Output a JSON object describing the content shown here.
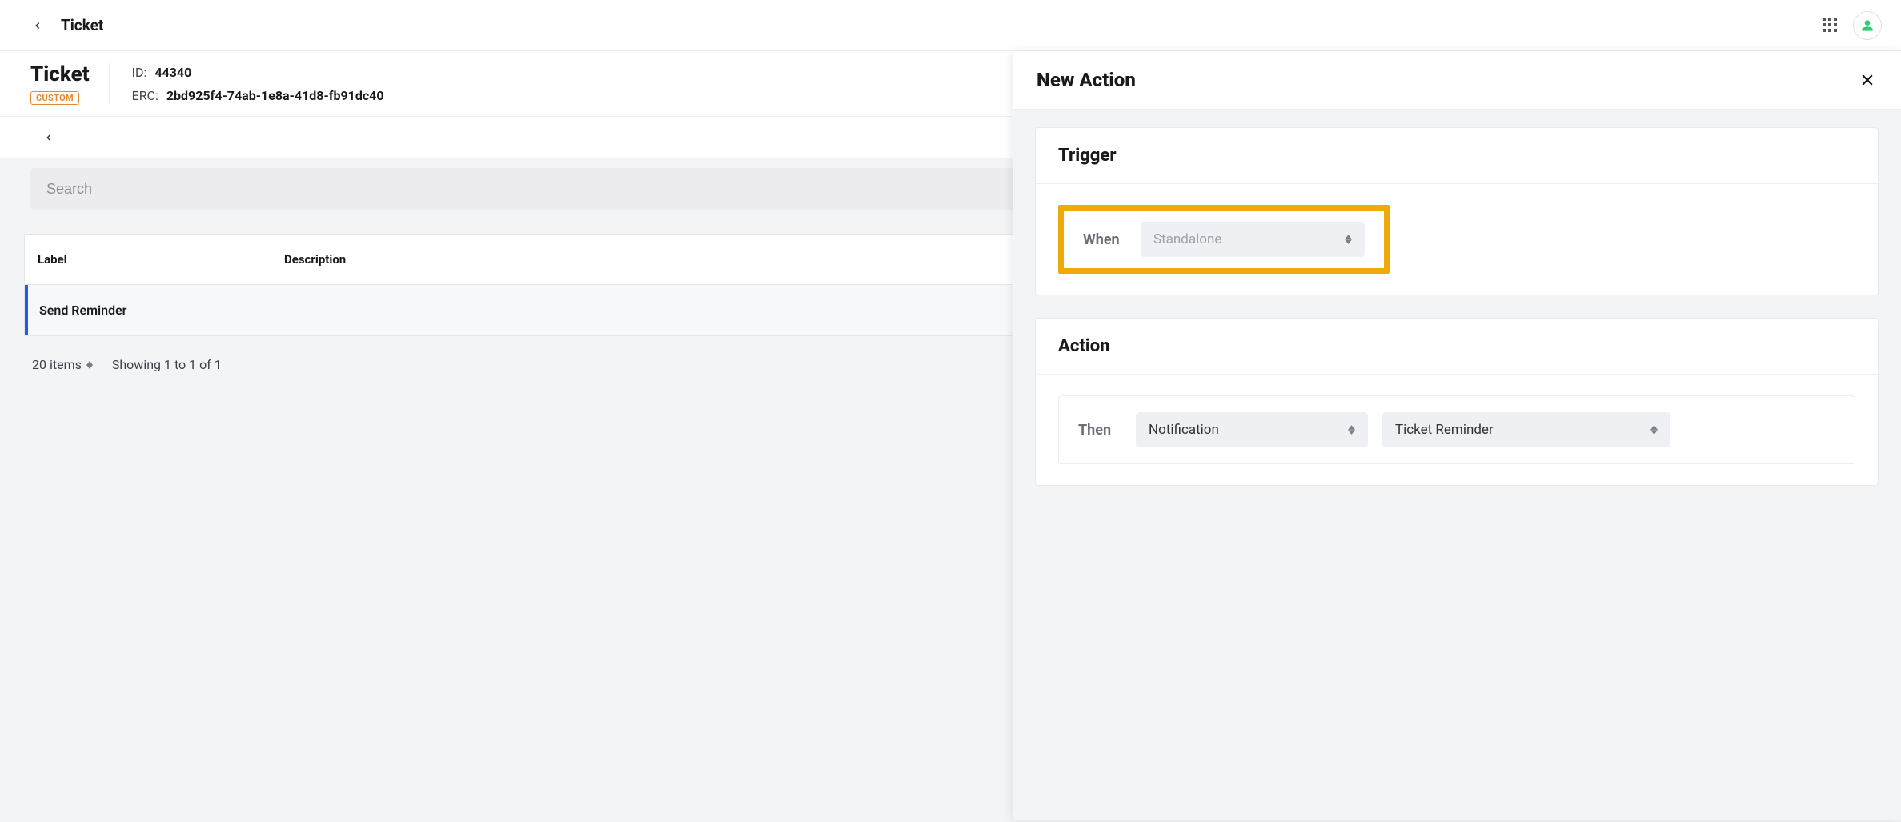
{
  "topbar": {
    "title": "Ticket"
  },
  "header": {
    "object_title": "Ticket",
    "badge": "CUSTOM",
    "id_label": "ID:",
    "id_value": "44340",
    "erc_label": "ERC:",
    "erc_value": "2bd925f4-74ab-1e8a-41d8-fb91dc40"
  },
  "search": {
    "placeholder": "Search"
  },
  "table": {
    "columns": {
      "label": "Label",
      "description": "Description"
    },
    "rows": [
      {
        "label": "Send Reminder",
        "description": ""
      }
    ],
    "footer": {
      "items_label": "20 items",
      "showing": "Showing 1 to 1 of 1"
    }
  },
  "panel": {
    "title": "New Action",
    "trigger": {
      "section_title": "Trigger",
      "when_label": "When",
      "when_value": "Standalone"
    },
    "action": {
      "section_title": "Action",
      "then_label": "Then",
      "then_value": "Notification",
      "target_value": "Ticket Reminder"
    }
  }
}
